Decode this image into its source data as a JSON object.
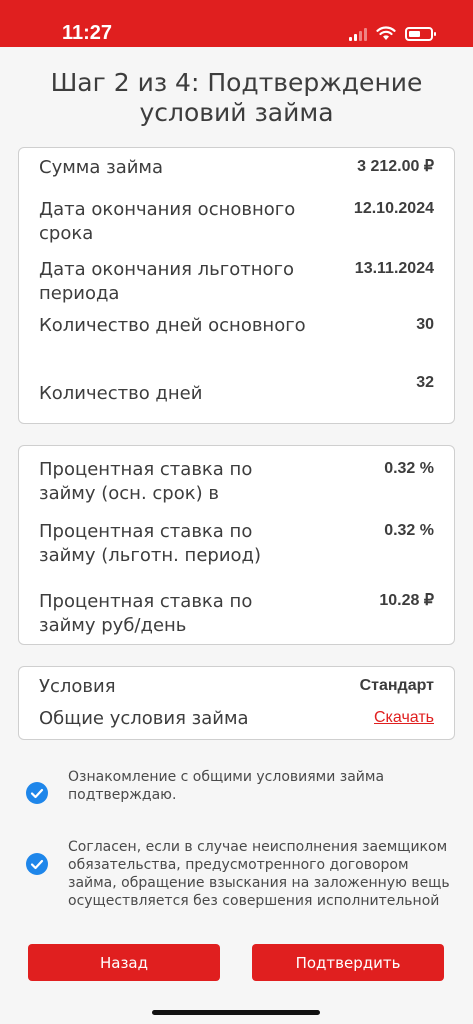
{
  "status_bar": {
    "time": "11:27",
    "battery_level": 0.55
  },
  "page": {
    "title": "Шаг 2 из 4: Подтверждение условий займа"
  },
  "loan_card": {
    "rows": [
      {
        "label": "Сумма займа",
        "value": "3 212.00 ₽"
      },
      {
        "label": "Дата окончания основного срока",
        "value": "12.10.2024"
      },
      {
        "label": "Дата окончания льготного периода",
        "value": "13.11.2024"
      },
      {
        "label": "Количество дней основного",
        "value": "30"
      },
      {
        "label": "Количество дней",
        "value": "32"
      }
    ]
  },
  "rate_card": {
    "rows": [
      {
        "label": "Процентная ставка по займу (осн. срок) в",
        "value": "0.32 %"
      },
      {
        "label": "Процентная ставка по займу (льготн. период)",
        "value": "0.32 %"
      },
      {
        "label": "Процентная ставка по займу руб/день",
        "value": "10.28 ₽"
      }
    ]
  },
  "terms_card": {
    "conditions_label": "Условия",
    "conditions_value": "Стандарт",
    "general_label": "Общие условия займа",
    "download_label": "Скачать"
  },
  "agreements": [
    {
      "text": "Ознакомление с общими условиями займа подтверждаю.",
      "checked": true
    },
    {
      "text": "Согласен, если в случае неисполнения заемщиком обязательства, предусмотренного договором займа, обращение взыскания на заложенную вещь осуществляется без совершения исполнительной",
      "checked": true
    }
  ],
  "buttons": {
    "back": "Назад",
    "confirm": "Подтвердить"
  },
  "colors": {
    "accent": "#e01f1f",
    "checkbox": "#1e86ea",
    "background": "#f6f6f6"
  }
}
